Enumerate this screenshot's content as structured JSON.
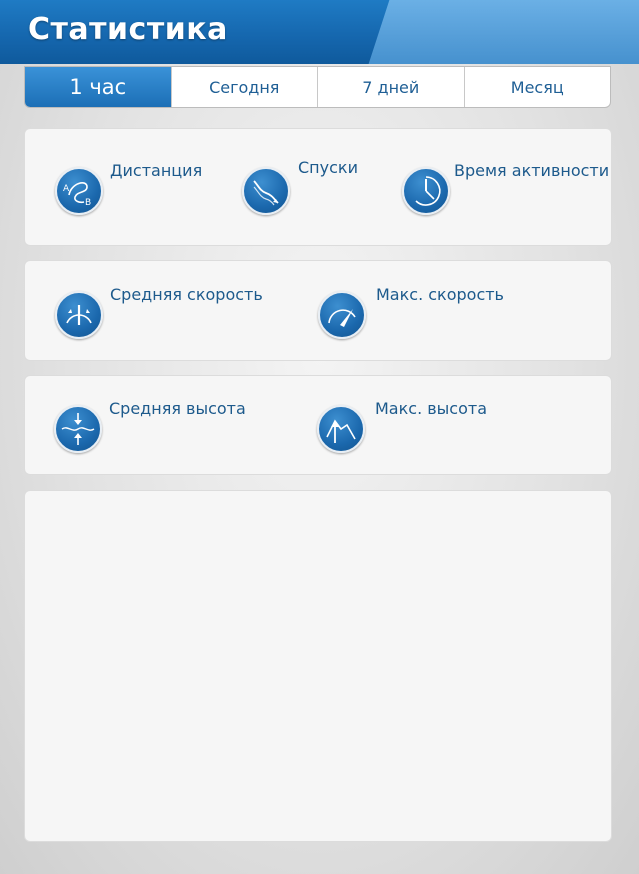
{
  "header": {
    "title": "Статистика"
  },
  "tabs": [
    {
      "label": "1 час",
      "active": true
    },
    {
      "label": "Сегодня",
      "active": false
    },
    {
      "label": "7 дней",
      "active": false
    },
    {
      "label": "Месяц",
      "active": false
    }
  ],
  "stats": {
    "distance": {
      "label": "Дистанция",
      "icon": "distance-icon"
    },
    "descents": {
      "label": "Спуски",
      "icon": "descents-icon"
    },
    "active_time": {
      "label": "Время активности",
      "icon": "clock-icon"
    },
    "avg_speed": {
      "label": "Средняя скорость",
      "icon": "speedometer-icon"
    },
    "max_speed": {
      "label": "Макс. скорость",
      "icon": "gauge-icon"
    },
    "avg_altitude": {
      "label": "Средняя высота",
      "icon": "altitude-avg-icon"
    },
    "max_altitude": {
      "label": "Макс. высота",
      "icon": "altitude-max-icon"
    }
  },
  "colors": {
    "accent": "#1b6db3",
    "label": "#1d5a8c",
    "panel": "#f6f6f6"
  }
}
